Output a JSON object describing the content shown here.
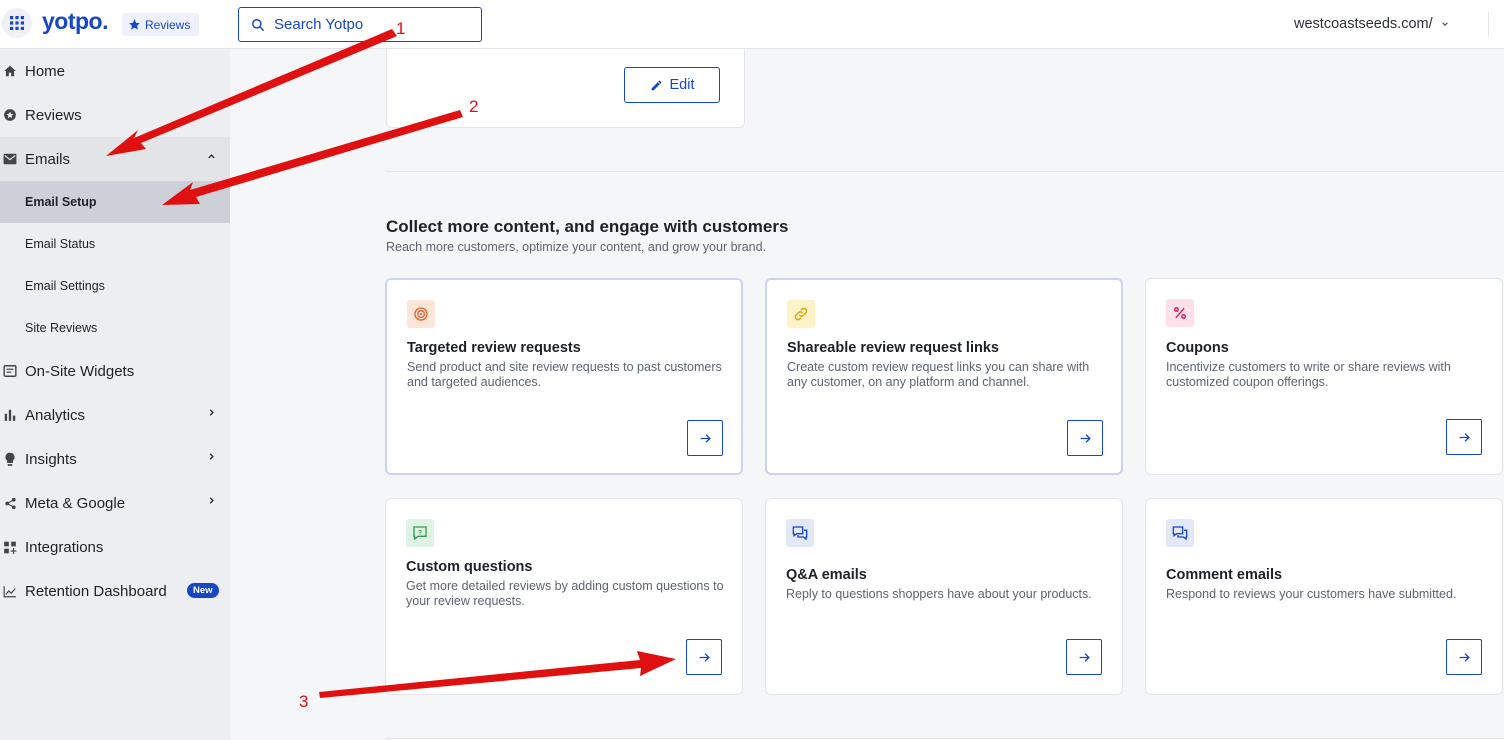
{
  "topbar": {
    "brand": "yotpo.",
    "product_badge": "Reviews",
    "search_placeholder": "Search Yotpo",
    "store": "westcoastseeds.com/"
  },
  "sidebar": {
    "items": [
      {
        "label": "Home",
        "icon": "home-icon"
      },
      {
        "label": "Reviews",
        "icon": "star-circle-icon"
      },
      {
        "label": "Emails",
        "icon": "mail-icon"
      },
      {
        "label": "On-Site Widgets",
        "icon": "widget-icon"
      },
      {
        "label": "Analytics",
        "icon": "bar-chart-icon"
      },
      {
        "label": "Insights",
        "icon": "lightbulb-icon"
      },
      {
        "label": "Meta & Google",
        "icon": "share-icon"
      },
      {
        "label": "Integrations",
        "icon": "grid-plus-icon"
      },
      {
        "label": "Retention Dashboard",
        "icon": "line-chart-icon"
      }
    ],
    "email_sub_items": [
      "Email Setup",
      "Email Status",
      "Email Settings",
      "Site Reviews"
    ],
    "new_badge": "New"
  },
  "main": {
    "edit_label": "Edit",
    "section_title": "Collect more content, and engage with customers",
    "section_subtitle": "Reach more customers, optimize your content, and grow your brand.",
    "cards": [
      {
        "title": "Targeted review requests",
        "desc": "Send product and site review requests to past customers and targeted audiences.",
        "icon": "target-icon",
        "icon_bg": "#fde6d8"
      },
      {
        "title": "Shareable review request links",
        "desc": "Create custom review request links you can share with any customer, on any platform and channel.",
        "icon": "link-icon",
        "icon_bg": "#fdf3c7"
      },
      {
        "title": "Coupons",
        "desc": "Incentivize customers to write or share reviews with customized coupon offerings.",
        "icon": "percent-icon",
        "icon_bg": "#fde0ea"
      },
      {
        "title": "Custom questions",
        "desc": "Get more detailed reviews by adding custom questions to your review requests.",
        "icon": "question-bubble-icon",
        "icon_bg": "#dff3e4"
      },
      {
        "title": "Q&A emails",
        "desc": "Reply to questions shoppers have about your products.",
        "icon": "chat-bubbles-icon",
        "icon_bg": "#e2e8f8"
      },
      {
        "title": "Comment emails",
        "desc": "Respond to reviews your customers have submitted.",
        "icon": "chat-bubbles-icon",
        "icon_bg": "#e2e8f8"
      }
    ]
  },
  "annotations": [
    "1",
    "2",
    "3"
  ],
  "colors": {
    "accent": "#1746c6",
    "annotation": "#e01010"
  }
}
